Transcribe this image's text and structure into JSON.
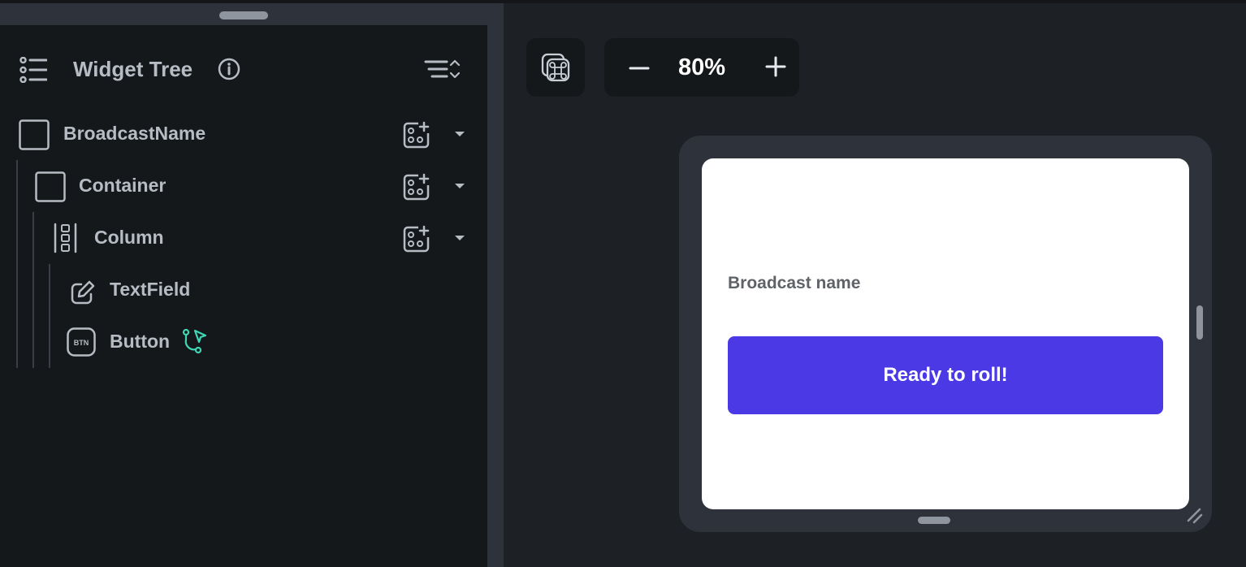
{
  "widget_tree": {
    "title": "Widget Tree",
    "header_icons": [
      "list-tree-icon",
      "info-icon",
      "collapse-sort-icon"
    ],
    "items": [
      {
        "label": "BroadcastName",
        "icon": "square-icon",
        "depth": 0,
        "actions": [
          "add-widget-icon",
          "dropdown-arrow-icon"
        ]
      },
      {
        "label": "Container",
        "icon": "square-icon",
        "depth": 1,
        "actions": [
          "add-widget-icon",
          "dropdown-arrow-icon"
        ]
      },
      {
        "label": "Column",
        "icon": "column-icon",
        "depth": 2,
        "actions": [
          "add-widget-icon",
          "dropdown-arrow-icon"
        ]
      },
      {
        "label": "TextField",
        "icon": "edit-pencil-icon",
        "depth": 3,
        "actions": []
      },
      {
        "label": "Button",
        "icon": "btn-icon",
        "badge": "BTN",
        "depth": 3,
        "actions": [
          "action-flow-icon"
        ]
      }
    ]
  },
  "canvas": {
    "zoom": {
      "minus_label": "−",
      "value": "80%",
      "plus_label": "+"
    },
    "command_icon": "command-key-icon",
    "preview": {
      "field_label": "Broadcast name",
      "button_label": "Ready to roll!"
    }
  },
  "colors": {
    "panel_bg": "#15181b",
    "canvas_bg": "#1d2025",
    "accent_button": "#4b39e6",
    "action_flow": "#3fd6b4"
  }
}
